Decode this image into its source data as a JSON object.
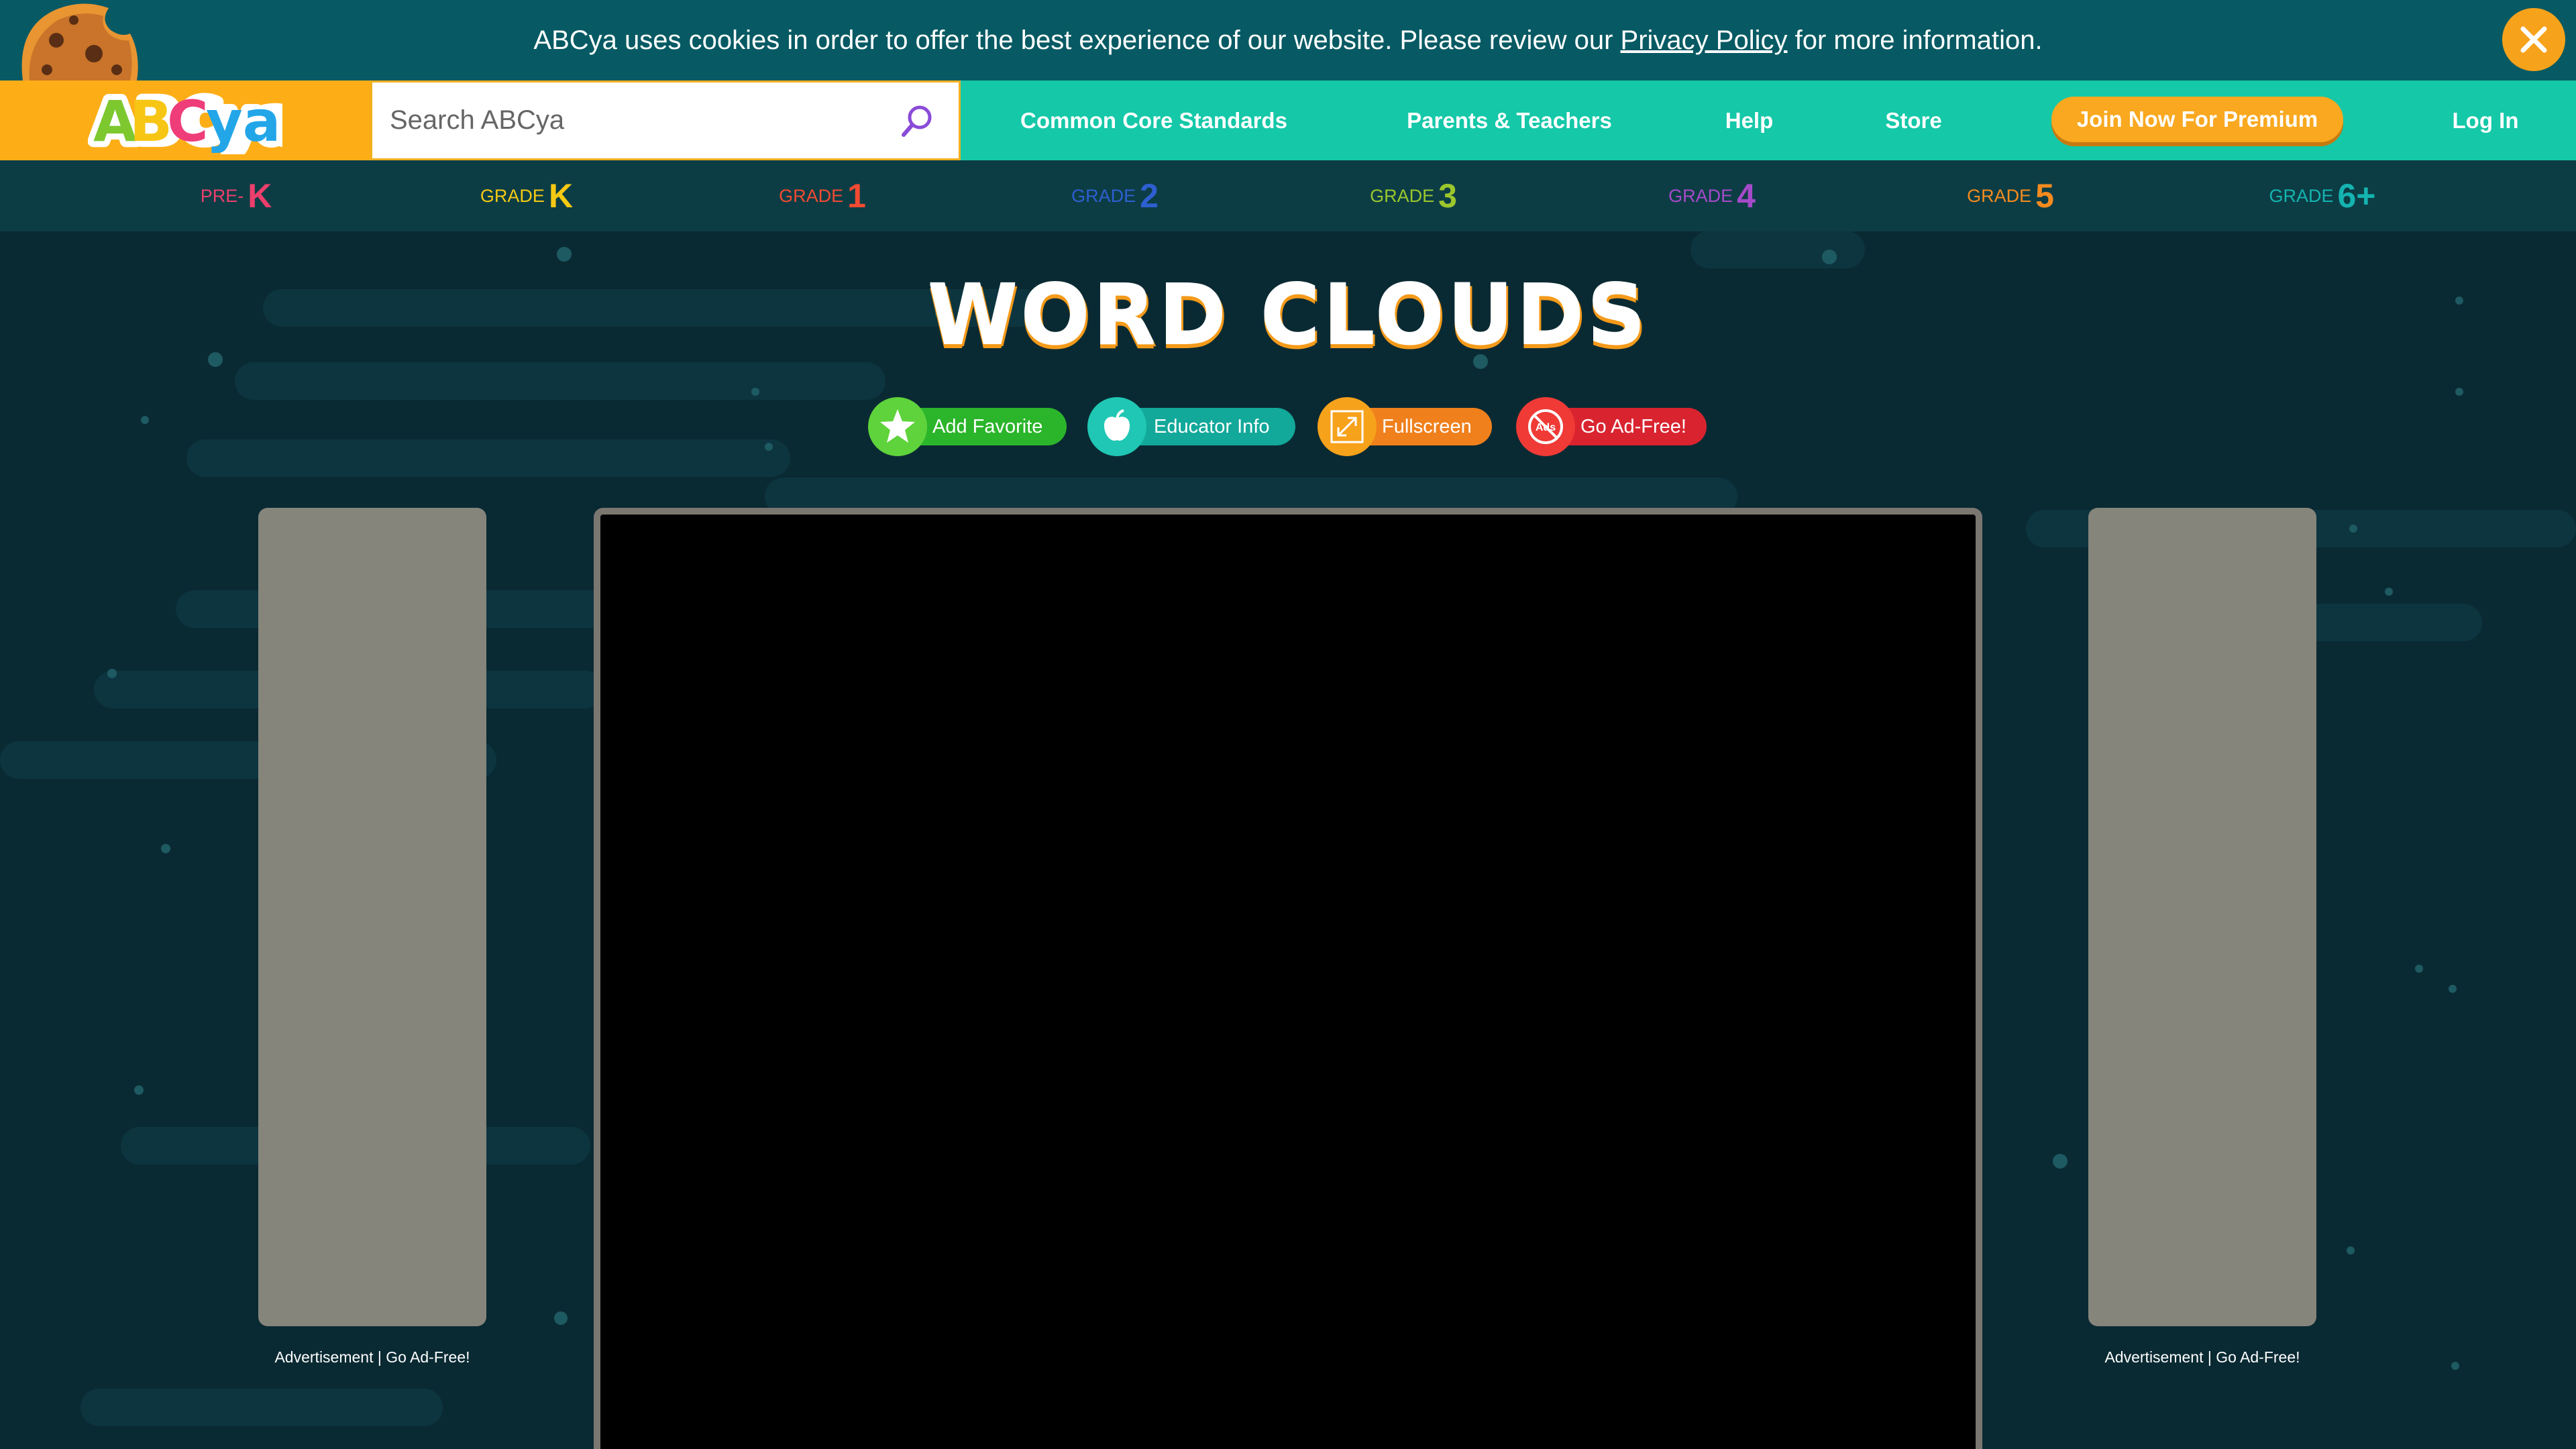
{
  "cookie_banner": {
    "message_before": "ABCya uses cookies in order to offer the best experience of our website. Please review our ",
    "link": "Privacy Policy",
    "message_after": " for more information."
  },
  "header": {
    "logo": "ABCya",
    "search_placeholder": "Search ABCya",
    "nav": [
      "Common Core Standards",
      "Parents & Teachers",
      "Help",
      "Store"
    ],
    "join_button": "Join Now For Premium",
    "login": "Log In"
  },
  "grades": [
    {
      "prefix": "PRE-",
      "num": "K",
      "color": "#ec3f6c"
    },
    {
      "prefix": "GRADE",
      "num": "K",
      "color": "#f6c913"
    },
    {
      "prefix": "GRADE",
      "num": "1",
      "color": "#f04a32"
    },
    {
      "prefix": "GRADE",
      "num": "2",
      "color": "#2e5fd1"
    },
    {
      "prefix": "GRADE",
      "num": "3",
      "color": "#9bc72d"
    },
    {
      "prefix": "GRADE",
      "num": "4",
      "color": "#a64ac9"
    },
    {
      "prefix": "GRADE",
      "num": "5",
      "color": "#f58b1f"
    },
    {
      "prefix": "GRADE",
      "num": "6+",
      "color": "#15b4b0"
    }
  ],
  "game": {
    "title": "WORD CLOUDS",
    "actions": [
      {
        "label": "Add Favorite",
        "icon": "star-icon",
        "color": "#2bb52a",
        "circle": "#5fd33b"
      },
      {
        "label": "Educator Info",
        "icon": "apple-icon",
        "color": "#12a89a",
        "circle": "#1fc7b4"
      },
      {
        "label": "Fullscreen",
        "icon": "fullscreen-icon",
        "color": "#f0801c",
        "circle": "#f7a21b"
      },
      {
        "label": "Go Ad-Free!",
        "icon": "no-ads-icon",
        "color": "#d92430",
        "circle": "#ef3a36"
      }
    ]
  },
  "ads": {
    "label": "Advertisement | Go Ad-Free!"
  }
}
